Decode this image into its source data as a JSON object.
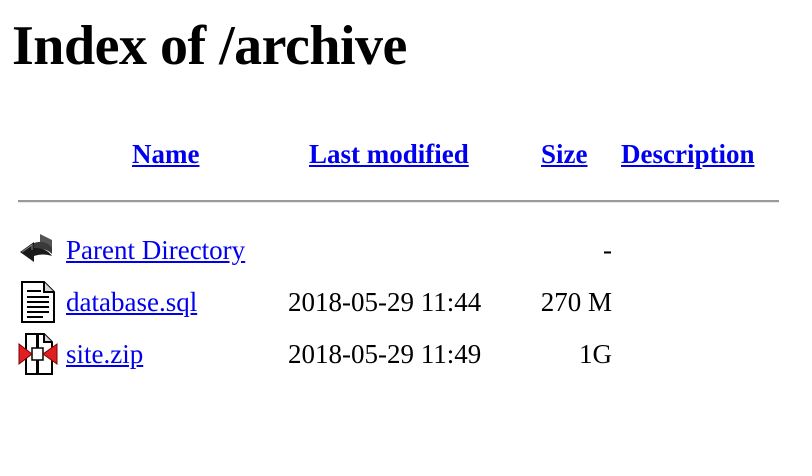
{
  "page": {
    "title": "Index of /archive"
  },
  "columns": {
    "name": "Name",
    "last_modified": "Last modified",
    "size": "Size",
    "description": "Description"
  },
  "rows": [
    {
      "icon": "parent-directory-icon",
      "name": "Parent Directory",
      "last_modified": "",
      "size": "-",
      "description": ""
    },
    {
      "icon": "text-file-icon",
      "name": "database.sql",
      "last_modified": "2018-05-29 11:44",
      "size": "270 M",
      "description": ""
    },
    {
      "icon": "compressed-file-icon",
      "name": "site.zip",
      "last_modified": "2018-05-29 11:49",
      "size": "1G",
      "description": ""
    }
  ],
  "colors": {
    "link": "#0000ee",
    "rule": "#9a9a9a",
    "zip_accent": "#e02020"
  }
}
